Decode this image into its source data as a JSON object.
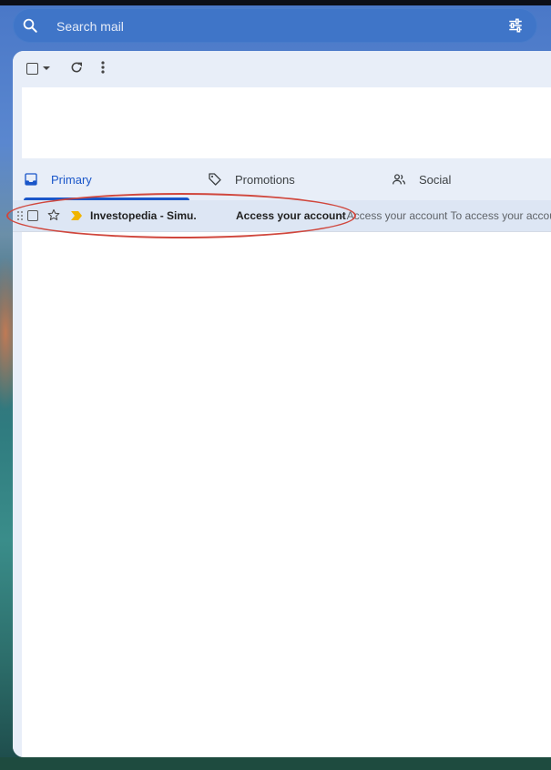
{
  "search": {
    "placeholder": "Search mail"
  },
  "toolbar": {
    "select_label": "",
    "refresh_label": "",
    "more_label": ""
  },
  "tabs": [
    {
      "label": "Primary",
      "icon": "inbox-icon",
      "active": true
    },
    {
      "label": "Promotions",
      "icon": "tag-icon",
      "active": false
    },
    {
      "label": "Social",
      "icon": "people-icon",
      "active": false
    }
  ],
  "email": {
    "sender": "Investopedia - Simu.",
    "subject": "Access your account",
    "snippet": " - Access your account To access your accour",
    "important": true,
    "starred": false
  },
  "colors": {
    "accent": "#1a56c9",
    "search_bar": "#3f75c8",
    "selected_row": "#dde6f4",
    "annotation": "#d0473d",
    "important_marker": "#f0b400"
  }
}
